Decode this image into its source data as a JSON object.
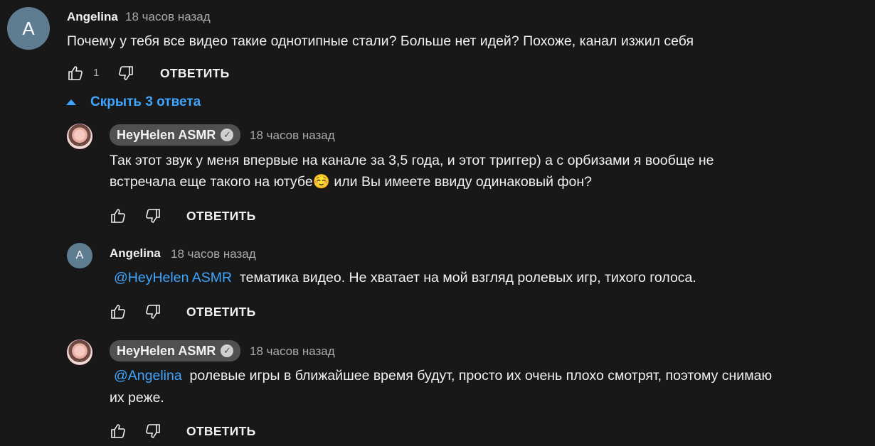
{
  "top_comment": {
    "avatar_letter": "A",
    "author": "Angelina",
    "time": "18 часов назад",
    "text": "Почему у тебя все видео такие однотипные стали? Больше нет идей? Похоже, канал изжил себя",
    "like_count": "1",
    "reply_label": "ОТВЕТИТЬ"
  },
  "replies_toggle": {
    "label": "Скрыть 3 ответа"
  },
  "replies": [
    {
      "author": "HeyHelen ASMR",
      "time": "18 часов назад",
      "mention": "",
      "text_line1": "Так этот звук у меня впервые на канале за 3,5 года, и этот триггер) а с орбизами я вообще не",
      "text_line2": "встречала еще такого на ютубе☺️ или Вы имеете ввиду одинаковый фон?",
      "reply_label": "ОТВЕТИТЬ"
    },
    {
      "avatar_letter": "A",
      "author": "Angelina",
      "time": "18 часов назад",
      "mention": "@HeyHelen ASMR",
      "text_line1": "тематика видео. Не хватает на мой взгляд ролевых игр, тихого голоса.",
      "reply_label": "ОТВЕТИТЬ"
    },
    {
      "author": "HeyHelen ASMR",
      "time": "18 часов назад",
      "mention": "@Angelina",
      "text_line1": "ролевые игры в ближайшее время будут, просто их очень плохо смотрят, поэтому снимаю",
      "text_line2": "их реже.",
      "reply_label": "ОТВЕТИТЬ"
    }
  ],
  "colors": {
    "background": "#181818",
    "link": "#3ea6ff",
    "secondary_text": "#aaaaaa",
    "badge": "#505050"
  }
}
